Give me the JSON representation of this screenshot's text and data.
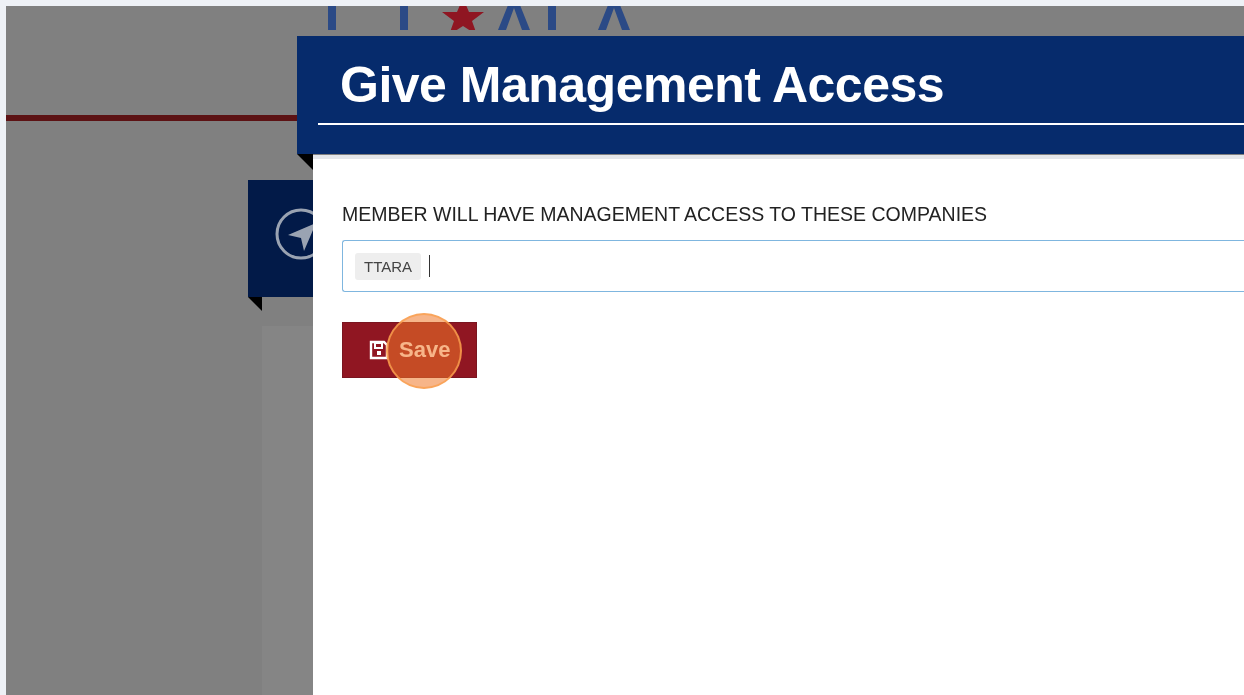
{
  "dialog": {
    "title": "Give Management Access",
    "field": {
      "label": "MEMBER WILL HAVE MANAGEMENT ACCESS TO THESE COMPANIES",
      "tags": [
        "TTARA"
      ]
    },
    "buttons": [
      {
        "label": "Save"
      }
    ]
  }
}
